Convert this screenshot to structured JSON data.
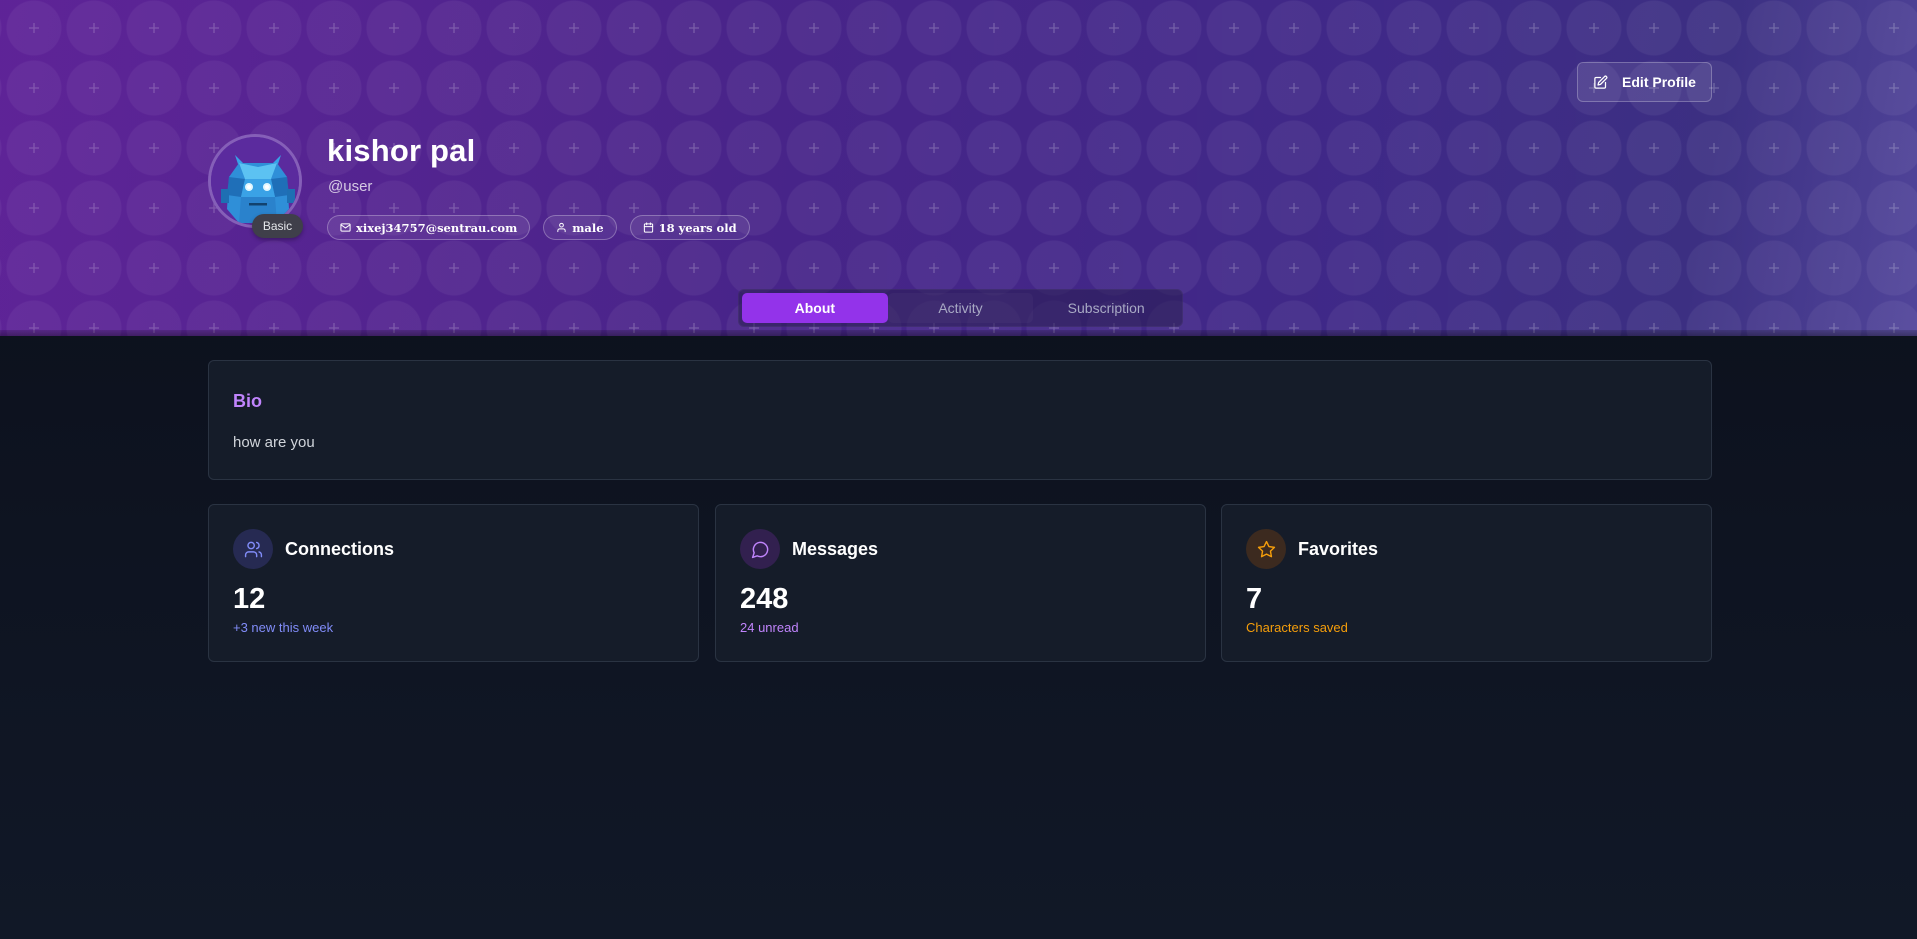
{
  "header": {
    "edit_button": "Edit Profile",
    "badge": "Basic",
    "name": "kishor pal",
    "handle": "@user",
    "chips": {
      "email": "xixej34757@sentrau.com",
      "gender": "male",
      "age": "18 years old"
    }
  },
  "tabs": [
    {
      "label": "About",
      "active": true
    },
    {
      "label": "Activity",
      "active": false
    },
    {
      "label": "Subscription",
      "active": false
    }
  ],
  "bio": {
    "title": "Bio",
    "text": "how are you"
  },
  "stats": [
    {
      "label": "Connections",
      "value": "12",
      "sub": "+3 new this week",
      "icon": "users-icon",
      "accent": "#818cf8",
      "icon_bg": "#262a52"
    },
    {
      "label": "Messages",
      "value": "248",
      "sub": "24 unread",
      "icon": "message-circle-icon",
      "accent": "#c084fc",
      "icon_bg": "#32204f"
    },
    {
      "label": "Favorites",
      "value": "7",
      "sub": "Characters saved",
      "icon": "star-icon",
      "accent": "#f59e0b",
      "icon_bg": "#3c2a1f"
    }
  ],
  "colors": {
    "accent_purple": "#9333ea",
    "bio_title": "#c084fc",
    "page_bg": "#111827",
    "card_bg": "#151c29"
  }
}
